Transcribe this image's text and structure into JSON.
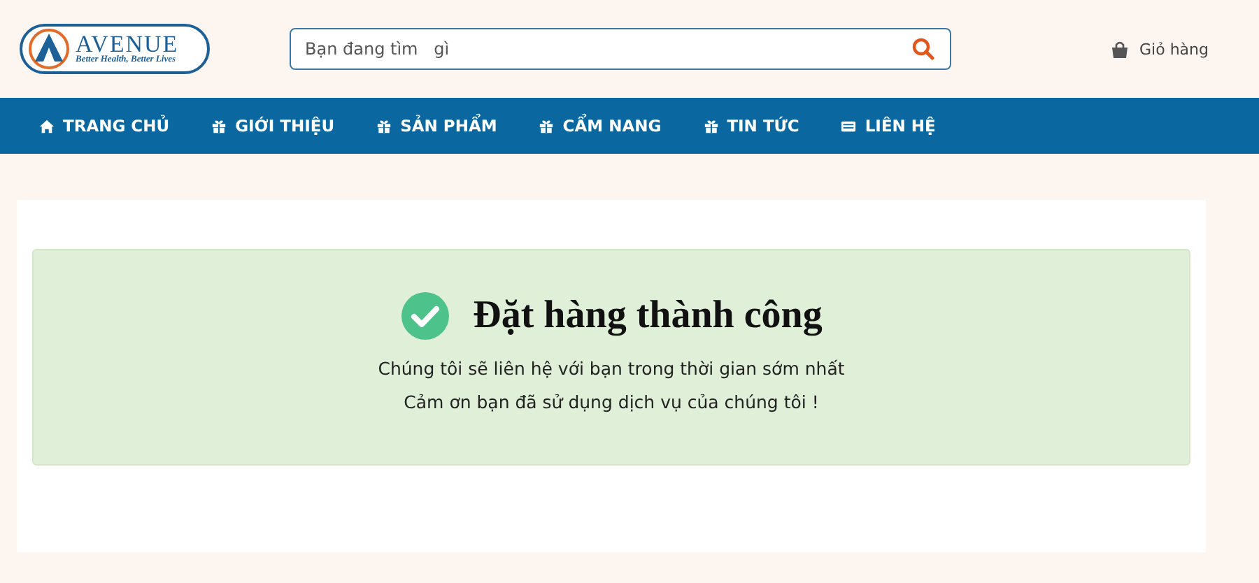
{
  "logo": {
    "name": "AVENUE",
    "tagline": "Better Health, Better Lives"
  },
  "search": {
    "placeholder": "Bạn đang tìm   gì"
  },
  "cart": {
    "label": "Giỏ hàng"
  },
  "nav": [
    {
      "label": "TRANG CHỦ",
      "kind": "home"
    },
    {
      "label": "GIỚI THIỆU",
      "kind": "gift"
    },
    {
      "label": "SẢN PHẨM",
      "kind": "gift"
    },
    {
      "label": "CẨM NANG",
      "kind": "gift"
    },
    {
      "label": "TIN TỨC",
      "kind": "gift"
    },
    {
      "label": "LIÊN HỆ",
      "kind": "card"
    }
  ],
  "message": {
    "title": "Đặt hàng thành công",
    "lines": [
      "Chúng tôi sẽ liên hệ với bạn trong thời gian sớm nhất",
      "Cảm ơn bạn đã sử dụng dịch vụ của chúng tôi !"
    ]
  }
}
